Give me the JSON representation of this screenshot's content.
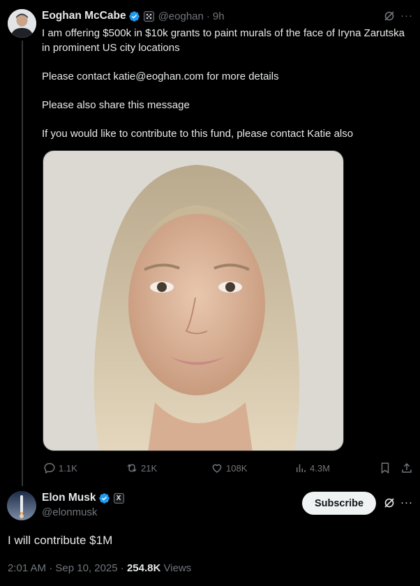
{
  "original_tweet": {
    "author_name": "Eoghan McCabe",
    "handle": "@eoghan",
    "separator": "·",
    "time_ago": "9h",
    "affiliation_badge_icon": "organization-badge-icon",
    "verified_color": "#1d9bf0",
    "paragraphs": [
      "I am offering $500k in $10k grants to paint murals of the face of Iryna Zarutska in prominent US city locations",
      "Please contact katie@eoghan.com for more details",
      "Please also share this message",
      "If you would like to contribute to this fund, please contact Katie also"
    ],
    "stats": {
      "replies": "1.1K",
      "reposts": "21K",
      "likes": "108K",
      "views": "4.3M"
    }
  },
  "reply_tweet": {
    "author_name": "Elon Musk",
    "handle": "@elonmusk",
    "affiliation_badge_text": "X",
    "subscribe_label": "Subscribe",
    "text": "I will contribute $1M",
    "timestamp": "2:01 AM · Sep 10, 2025",
    "separator": " · ",
    "views_count": "254.8K",
    "views_label": " Views"
  },
  "colors": {
    "background": "#000000",
    "text_primary": "#e7e9ea",
    "text_secondary": "#71767b",
    "verified_blue": "#1d9bf0",
    "thread_line": "#333639"
  }
}
